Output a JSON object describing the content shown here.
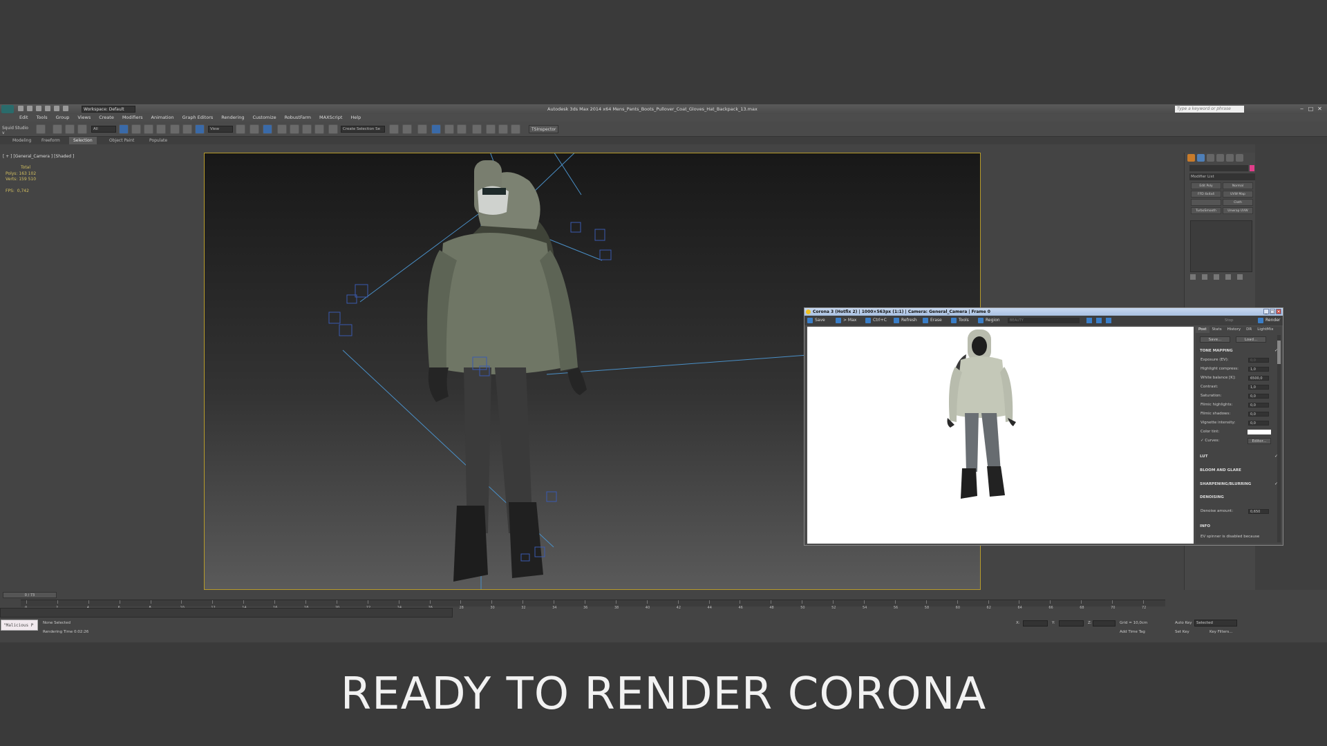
{
  "titlebar": {
    "workspace": "Workspace: Default",
    "title": "Autodesk 3ds Max  2014 x64     Mens_Pants_Boots_Pullover_Coat_Gloves_Hat_Backpack_13.max",
    "search_placeholder": "Type a keyword or phrase"
  },
  "menu": [
    "Edit",
    "Tools",
    "Group",
    "Views",
    "Create",
    "Modifiers",
    "Animation",
    "Graph Editors",
    "Rendering",
    "Customize",
    "RobustFarm",
    "MAXScript",
    "Help"
  ],
  "toolbar": {
    "squid": "Squid Studio v",
    "all_filter": "All",
    "view_dd": "View",
    "selection_set": "Create Selection Se",
    "tsinspector": "TSInspector"
  },
  "ribbon": {
    "tabs": [
      "Modeling",
      "Freeform",
      "Selection",
      "Object Paint",
      "Populate"
    ],
    "active": "Selection"
  },
  "viewport": {
    "label": "[ + ] [General_Camera ] [Shaded ]",
    "stats_total": "Total",
    "polys_label": "Polys:",
    "polys": "163 102",
    "verts_label": "Verts:",
    "verts": "159 510",
    "fps_label": "FPS:",
    "fps": "0,742"
  },
  "command_panel": {
    "modifier_list": "Modifier List",
    "modifiers": [
      "Edit Poly",
      "Normal",
      "FFD 4x4x4",
      "UVW Map",
      "",
      "Cloth",
      "TurboSmooth",
      "Unwrap UVW"
    ]
  },
  "timeline": {
    "frame_slider": "0 / 73",
    "ticks": [
      "0",
      "2",
      "4",
      "6",
      "8",
      "10",
      "12",
      "14",
      "16",
      "18",
      "20",
      "22",
      "24",
      "26",
      "28",
      "30",
      "32",
      "34",
      "36",
      "38",
      "40",
      "42",
      "44",
      "46",
      "48",
      "50",
      "52",
      "54",
      "56",
      "58",
      "60",
      "62",
      "64",
      "66",
      "68",
      "70",
      "72"
    ]
  },
  "status": {
    "maxscript": "\"Malicious P",
    "none_selected": "None Selected",
    "render_time": "Rendering Time  0:02:26",
    "x": "X:",
    "y": "Y:",
    "z": "Z:",
    "grid": "Grid = 10,0cm",
    "add_time_tag": "Add Time Tag",
    "auto_key": "Auto Key",
    "selected": "Selected",
    "set_key": "Set Key",
    "key_filters": "Key Filters..."
  },
  "vfb": {
    "title": "Corona 3 (Hotfix 2) | 1000×563px (1:1) | Camera: General_Camera | Frame 0",
    "toolbar": [
      "Save",
      "> Max",
      "Ctrl+C",
      "Refresh",
      "Erase",
      "Tools",
      "Region"
    ],
    "beauty": "BEAUTY",
    "stop": "Stop",
    "render": "Render",
    "tabs": [
      "Post",
      "Stats",
      "History",
      "DR",
      "LightMix"
    ],
    "active_tab": "Post",
    "save": "Save...",
    "load": "Load...",
    "tone_mapping": "TONE MAPPING",
    "rows": [
      {
        "label": "Exposure (EV):",
        "value": "0,0",
        "disabled": true
      },
      {
        "label": "Highlight compress:",
        "value": "1,0"
      },
      {
        "label": "White balance [K]:",
        "value": "6500,0"
      },
      {
        "label": "Contrast:",
        "value": "1,0"
      },
      {
        "label": "Saturation:",
        "value": "0,0"
      },
      {
        "label": "Filmic highlights:",
        "value": "0,0"
      },
      {
        "label": "Filmic shadows:",
        "value": "0,0"
      },
      {
        "label": "Vignette intensity:",
        "value": "0,0"
      }
    ],
    "color_tint": "Color tint:",
    "curves": "Curves:",
    "editor": "Editor...",
    "lut": "LUT",
    "bloom": "BLOOM AND GLARE",
    "sharpening": "SHARPENING/BLURRING",
    "denoising": "DENOISING",
    "denoise_amount_label": "Denoise amount:",
    "denoise_amount": "0,650",
    "info": "INFO",
    "info_text": "EV spinner is disabled because",
    "colors": {
      "titlebar": "#b9cdea",
      "accent": "#3a7ec8"
    }
  },
  "caption": "READY TO RENDER  CORONA"
}
